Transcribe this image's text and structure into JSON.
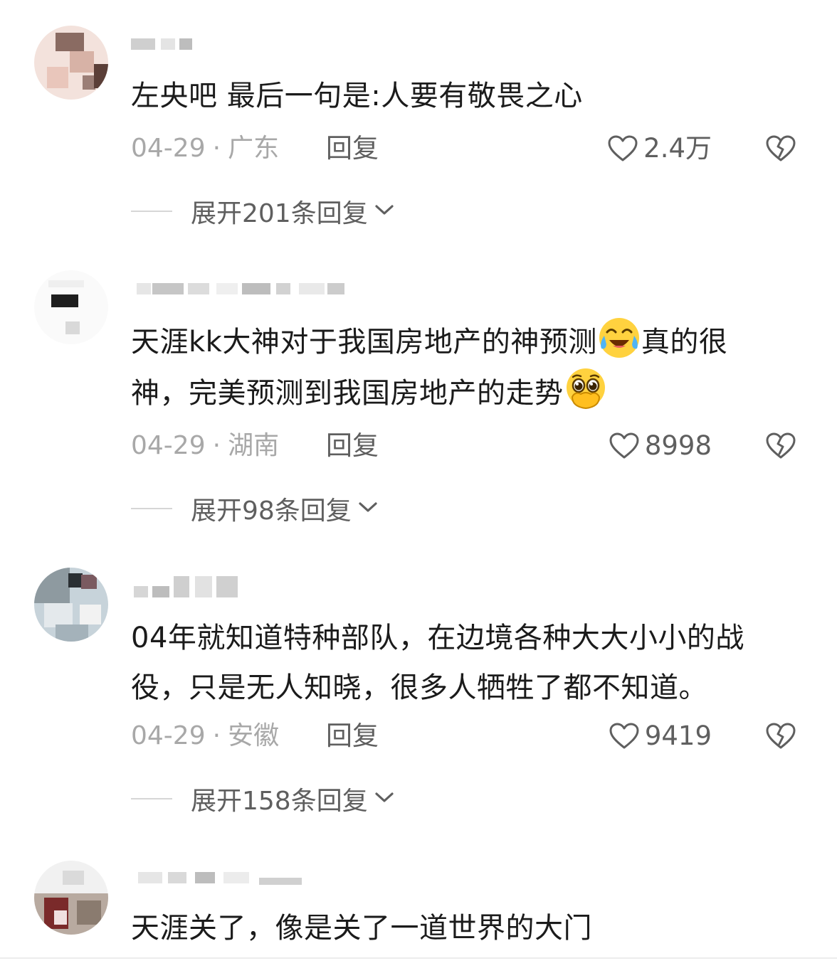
{
  "comments": [
    {
      "text": "左央吧 最后一句是:人要有敬畏之心",
      "date": "04-29",
      "location": "广东",
      "reply_label": "回复",
      "likes": "2.4万",
      "expand_label": "展开201条回复"
    },
    {
      "text_a": "天涯kk大神对于我国房地产的神预测",
      "text_b": "真的很",
      "text_c": "神，完美预测到我国房地产的走势",
      "date": "04-29",
      "location": "湖南",
      "reply_label": "回复",
      "likes": "8998",
      "expand_label": "展开98条回复"
    },
    {
      "text": "04年就知道特种部队，在边境各种大大小小的战役，只是无人知晓，很多人牺牲了都不知道。",
      "date": "04-29",
      "location": "安徽",
      "reply_label": "回复",
      "likes": "9419",
      "expand_label": "展开158条回复"
    },
    {
      "text": "天涯关了，像是关了一道世界的大门"
    }
  ],
  "meta_separator": "·",
  "icons": {
    "like": "heart-outline-icon",
    "dislike": "broken-heart-icon",
    "expand": "chevron-down-icon",
    "emoji_1": "crying-laughing-emoji",
    "emoji_2": "pleading-hand-over-mouth-emoji"
  },
  "colors": {
    "text": "#1b1b1b",
    "meta": "#a8a8a8",
    "secondary": "#5f5f5f"
  }
}
